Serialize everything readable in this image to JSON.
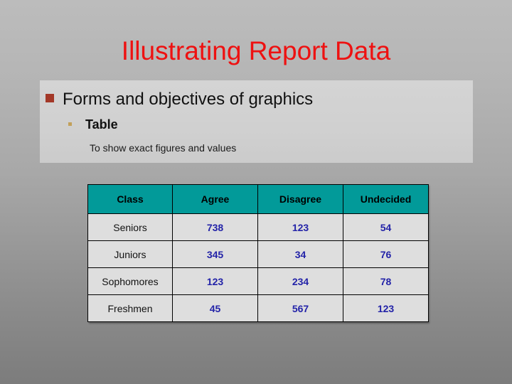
{
  "slide": {
    "title": "Illustrating Report Data",
    "title_color": "#ee1111",
    "background_top_color": "#bcbcbc",
    "background_bottom_color": "#7c7c7c",
    "panel_color": "#d0d0d0"
  },
  "outline": {
    "level1": {
      "text": "Forms and objectives of graphics",
      "bullet_glyph": "square-bullet",
      "bullet_color": "#a33828"
    },
    "level2": {
      "text": "Table",
      "bullet_glyph": "dot-bullet",
      "bullet_color": "#c2a05a"
    },
    "level3": {
      "text": "To show exact figures and values"
    }
  },
  "table": {
    "header_background": "#029a99",
    "cell_background": "#dedede",
    "number_color": "#2323a8",
    "columns": [
      "Class",
      "Agree",
      "Disagree",
      "Undecided"
    ],
    "rows": [
      {
        "label": "Seniors",
        "agree": "738",
        "disagree": "123",
        "undecided": "54"
      },
      {
        "label": "Juniors",
        "agree": "345",
        "disagree": "34",
        "undecided": "76"
      },
      {
        "label": "Sophomores",
        "agree": "123",
        "disagree": "234",
        "undecided": "78"
      },
      {
        "label": "Freshmen",
        "agree": "45",
        "disagree": "567",
        "undecided": "123"
      }
    ]
  },
  "chart_data": {
    "type": "table",
    "title": "Illustrating Report Data",
    "xlabel": "",
    "ylabel": "",
    "categories": [
      "Seniors",
      "Juniors",
      "Sophomores",
      "Freshmen"
    ],
    "series": [
      {
        "name": "Agree",
        "values": [
          738,
          345,
          123,
          45
        ]
      },
      {
        "name": "Disagree",
        "values": [
          123,
          34,
          234,
          567
        ]
      },
      {
        "name": "Undecided",
        "values": [
          54,
          76,
          78,
          123
        ]
      }
    ],
    "columns": [
      "Class",
      "Agree",
      "Disagree",
      "Undecided"
    ],
    "legend": "none",
    "grid": true
  }
}
